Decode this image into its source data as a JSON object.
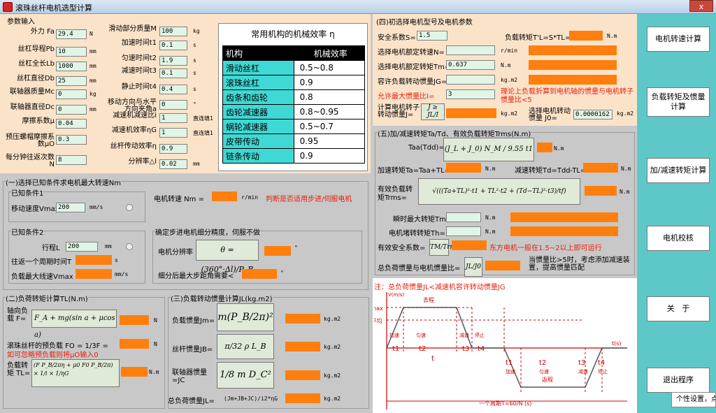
{
  "title": "滚珠丝杆电机选型计算",
  "close": "x",
  "params": {
    "legend": "参数输入",
    "rows": [
      {
        "label": "外力 Fa",
        "value": "29.4",
        "unit": "N"
      },
      {
        "label": "丝杠导程Pb",
        "value": "10",
        "unit": "mm"
      },
      {
        "label": "丝杠全长Lb",
        "value": "1000",
        "unit": "mm"
      },
      {
        "label": "丝杠直径Db",
        "value": "25",
        "unit": "mm"
      },
      {
        "label": "联轴器质量Mc",
        "value": "0",
        "unit": "kg"
      },
      {
        "label": "联轴器直径Dc",
        "value": "0",
        "unit": "mm"
      },
      {
        "label": "摩擦系数μ",
        "value": "0.04",
        "unit": ""
      },
      {
        "label": "预压螺帽摩擦系数μO",
        "value": "0.3",
        "unit": ""
      },
      {
        "label": "每分钟往返次数 N",
        "value": "8",
        "unit": ""
      }
    ],
    "rows2": [
      {
        "label": "滑动部分质量M",
        "value": "100",
        "unit": "kg"
      },
      {
        "label": "加速时间t1",
        "value": "0.1",
        "unit": "s"
      },
      {
        "label": "匀速时间t2",
        "value": "1.9",
        "unit": "s"
      },
      {
        "label": "减速时间t3",
        "value": "0.1",
        "unit": "s"
      },
      {
        "label": "静止时间t4",
        "value": "0.4",
        "unit": "s"
      },
      {
        "label": "移动方向与水平方向夹角a",
        "value": "0",
        "unit": "°"
      },
      {
        "label": "减速机减速比i",
        "value": "1",
        "unit": "直连填1"
      },
      {
        "label": "减速机效率ηG",
        "value": "1",
        "unit": "直连填1"
      },
      {
        "label": "丝杆传动效率η",
        "value": "0.9",
        "unit": ""
      },
      {
        "label": "分辨率△l",
        "value": "0.02",
        "unit": "mm"
      }
    ]
  },
  "efficiency": {
    "title": "常用机构的机械效率 η",
    "headers": [
      "机构",
      "机械效率"
    ],
    "rows": [
      [
        "滑动丝杠",
        "0.5~0.8"
      ],
      [
        "滚珠丝杠",
        "0.9"
      ],
      [
        "齿条和齿轮",
        "0.8"
      ],
      [
        "齿轮减速器",
        "0.8~0.95"
      ],
      [
        "蜗轮减速器",
        "0.5~0.7"
      ],
      [
        "皮带传动",
        "0.95"
      ],
      [
        "链条传动",
        "0.9"
      ]
    ]
  },
  "speed": {
    "legend": "(一)选择已知条件求电机最大转速Nm",
    "cond1": "已知条件1",
    "vmax_label": "移动速度Vmax",
    "vmax_value": "200",
    "vmax_unit": "mm/s",
    "motor_speed_label": "电机转速 Nm =",
    "motor_speed_unit": "r/min",
    "judge": "判断是否适用步进/伺服电机",
    "cond2": "已知条件2",
    "stroke_label": "行程L",
    "stroke_value": "200",
    "stroke_unit": "mm",
    "recent_label": "往返一个周期时间T",
    "recent_unit": "s",
    "vline_label": "负载最大线速Vmax",
    "vline_unit": "mm/s",
    "res_legend": "确定步进电机细分精度，伺服不做",
    "resolution_label": "电机分辨率",
    "resolution_formula": "θ = (360°·Δl)/P_B",
    "resolution_unit": "°",
    "step_label": "细分后最大步距角需要<",
    "step_unit": "°"
  },
  "torque": {
    "legend": "(二)负荷转矩计算TL(N.m)",
    "axial_label": "轴向负载 F=",
    "axial_formula": "F_A + mg(sin a + μcos a)",
    "axial_unit": "N",
    "preload_label": "滚珠丝杆的预负载  FO = 1/3F =",
    "preload_unit": "N",
    "preload_note": "如可忽略预负载则将μO输入0",
    "load_label": "负载转矩 TL=",
    "load_formula": "(F P_B/2πη + μ0 F0 P_B/2π) × 1/i × 1/ηG",
    "load_unit": "N.m"
  },
  "inertia": {
    "legend": "(三)负载转动惯量计算JL(kg.m2)",
    "jm_label": "负载惯量Jm=",
    "jm_formula": "m(P_B/2π)²",
    "jb_label": "丝杆惯量JB=",
    "jb_formula": "π/32 ρ L_B D_B⁴",
    "jc_label": "联轴器惯量=JC",
    "jc_formula": "1/8 m D_C²",
    "jl_label": "总负荷惯量JL=",
    "jl_formula": "(Jm+JB+JC)/i2*ηG",
    "unit": "kg.m2"
  },
  "motor": {
    "legend": "(四)初选择电机型号及电机参数",
    "safety_label": "安全系数S=",
    "safety_value": "1.5",
    "tl_label": "负载转矩T'L=S*TL=",
    "tl_unit": "N.m",
    "rated_speed_label": "选择电机额定转速N=",
    "rated_speed_unit": "r/min",
    "rated_torque_label": "选择电机额定转矩Tm=",
    "rated_torque_value": "0.637",
    "rated_torque_unit": "N.m",
    "jg_label": "容许负载转动惯量JG=",
    "jg_unit": "kg.m2",
    "ratio_label": "允许最大惯量比I=",
    "ratio_value": "3",
    "ratio_note": "理论上负载折算到电机轴的惯量与电机转子惯量比<5",
    "rotor_label": "计算电机转子转动惯量J=",
    "rotor_formula": "J ≥ JL/I",
    "rotor_unit": "kg.m2",
    "select_label": "选择电机转动惯量 J0=",
    "select_value": "0.0000162",
    "select_unit": "kg.m2"
  },
  "accel": {
    "legend": "(五)加/减速转矩Ta/Td、有效负载转矩Trms(N.m)",
    "taa_label": "Taa(Tdd)=",
    "taa_formula": "(J_L + J_0) N_M / 9.55 t1",
    "unit": "N.m",
    "ta_label": "加速转矩Ta=Taa+TL=",
    "td_label": "减速转矩Td=Tdd-TL=",
    "trms_label": "有效负载转矩Trms=",
    "trms_formula": "√(((Ta+TL)²·t1 + TL²·t2 + (Td−TL)²·t3)/tf)",
    "tmax_label": "瞬时最大转矩Tmax=",
    "th_label": "电机堵转转矩Th=",
    "safe_label": "有效安全系数=",
    "safe_formula": "TM/Trms",
    "safe_note": "东方电机一般在1.5~2以上即可运行",
    "inert_label": "总负荷惯量与电机惯量比=",
    "inert_formula": "JL/J0",
    "inert_note": "当惯量比>5时，考虑添加减速装置，提高惯量匹配",
    "warn": "注：总负荷惯量JL<减速机容许转动惯量JG"
  },
  "graph": {
    "vunit": "V(m/s)",
    "vmax": "Vmax",
    "vavg": "V平均",
    "go": "去程",
    "back": "返程",
    "tunit": "t(s)",
    "period": "一个周期T=60/N (s)",
    "labels_top": [
      "加速",
      "匀速",
      "减速",
      "停止"
    ],
    "t_labels": [
      "t1",
      "t2",
      "t3",
      "t4"
    ],
    "t_main": "t"
  },
  "buttons": [
    {
      "label": "电机转速计算"
    },
    {
      "label": "负载转矩及惯量计算"
    },
    {
      "label": "加/减速转矩计算"
    },
    {
      "label": "电机校核"
    },
    {
      "label": "关   于"
    },
    {
      "label": "退出程序"
    }
  ],
  "tooltip": "个性设置，点"
}
